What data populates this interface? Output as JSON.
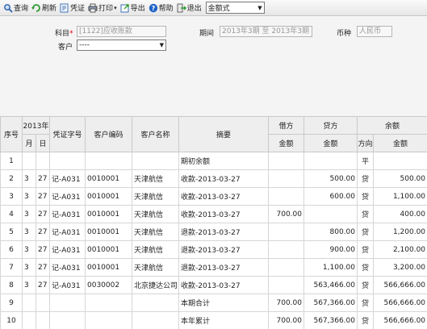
{
  "toolbar": {
    "query": "查询",
    "refresh": "刷新",
    "voucher": "凭证",
    "print": "打印",
    "export": "导出",
    "help": "帮助",
    "exit": "退出",
    "format": "金额式"
  },
  "filter": {
    "subject_label": "科目",
    "subject_required": "*",
    "subject_value": "[1122]应收账款",
    "period_label": "期间",
    "period_value": "2013年3期 至 2013年3期",
    "currency_label": "币种",
    "currency_value": "人民币",
    "customer_label": "客户",
    "customer_value": "----"
  },
  "table": {
    "headers": {
      "seq": "序号",
      "year": "2013年",
      "month": "月",
      "day": "日",
      "voucher_no": "凭证字号",
      "customer_code": "客户编码",
      "customer_name": "客户名称",
      "summary": "摘要",
      "debit": "借方",
      "credit": "贷方",
      "balance": "余额",
      "amount": "金额",
      "direction": "方向"
    },
    "rows": [
      {
        "seq": "1",
        "m": "",
        "d": "",
        "voucher": "",
        "code": "",
        "name": "",
        "summary": "期初余额",
        "debit": "",
        "credit": "",
        "dir": "平",
        "balance": ""
      },
      {
        "seq": "2",
        "m": "3",
        "d": "27",
        "voucher": "记-A031",
        "code": "0010001",
        "name": "天津航信",
        "summary": "收款-2013-03-27",
        "debit": "",
        "credit": "500.00",
        "dir": "贷",
        "balance": "500.00"
      },
      {
        "seq": "3",
        "m": "3",
        "d": "27",
        "voucher": "记-A031",
        "code": "0010001",
        "name": "天津航信",
        "summary": "收款-2013-03-27",
        "debit": "",
        "credit": "600.00",
        "dir": "贷",
        "balance": "1,100.00"
      },
      {
        "seq": "4",
        "m": "3",
        "d": "27",
        "voucher": "记-A031",
        "code": "0010001",
        "name": "天津航信",
        "summary": "收款-2013-03-27",
        "debit": "700.00",
        "credit": "",
        "dir": "贷",
        "balance": "400.00"
      },
      {
        "seq": "5",
        "m": "3",
        "d": "27",
        "voucher": "记-A031",
        "code": "0010001",
        "name": "天津航信",
        "summary": "退款-2013-03-27",
        "debit": "",
        "credit": "800.00",
        "dir": "贷",
        "balance": "1,200.00"
      },
      {
        "seq": "6",
        "m": "3",
        "d": "27",
        "voucher": "记-A031",
        "code": "0010001",
        "name": "天津航信",
        "summary": "退款-2013-03-27",
        "debit": "",
        "credit": "900.00",
        "dir": "贷",
        "balance": "2,100.00"
      },
      {
        "seq": "7",
        "m": "3",
        "d": "27",
        "voucher": "记-A031",
        "code": "0010001",
        "name": "天津航信",
        "summary": "退款-2013-03-27",
        "debit": "",
        "credit": "1,100.00",
        "dir": "贷",
        "balance": "3,200.00"
      },
      {
        "seq": "8",
        "m": "3",
        "d": "27",
        "voucher": "记-A031",
        "code": "0030002",
        "name": "北京捷达公司",
        "summary": "收款-2013-03-27",
        "debit": "",
        "credit": "563,466.00",
        "dir": "贷",
        "balance": "566,666.00"
      },
      {
        "seq": "9",
        "m": "",
        "d": "",
        "voucher": "",
        "code": "",
        "name": "",
        "summary": "本期合计",
        "debit": "700.00",
        "credit": "567,366.00",
        "dir": "贷",
        "balance": "566,666.00"
      },
      {
        "seq": "10",
        "m": "",
        "d": "",
        "voucher": "",
        "code": "",
        "name": "",
        "summary": "本年累计",
        "debit": "700.00",
        "credit": "567,366.00",
        "dir": "贷",
        "balance": "566,666.00"
      }
    ]
  }
}
